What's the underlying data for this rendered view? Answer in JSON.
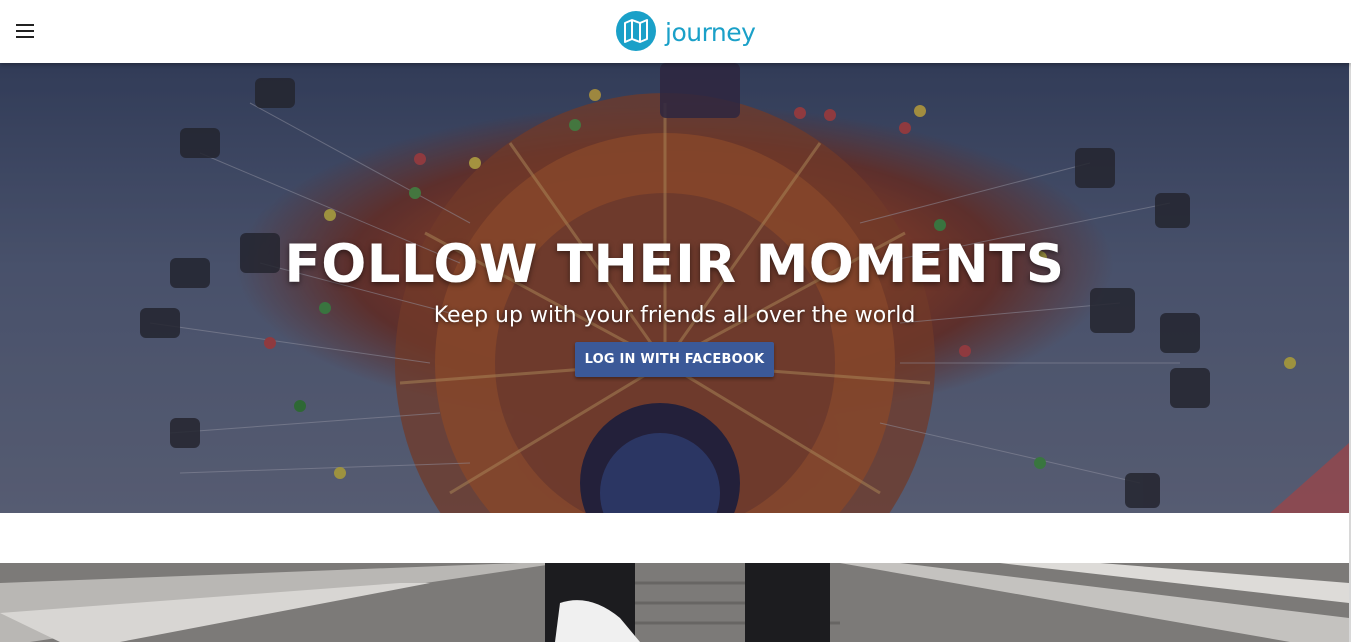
{
  "header": {
    "menu_icon": "hamburger-menu-icon",
    "logo_icon": "folded-map-icon",
    "logo_text": "journey",
    "brand_color": "#1aa0c8"
  },
  "hero": {
    "title": "FOLLOW THEIR MOMENTS",
    "subtitle": "Keep up with your friends all over the world",
    "cta_label": "LOG IN WITH FACEBOOK",
    "cta_color": "#3b5998",
    "background_image": "carousel-swing-ride-photo"
  },
  "next_section": {
    "background_image": "railway-tracks-photo"
  }
}
